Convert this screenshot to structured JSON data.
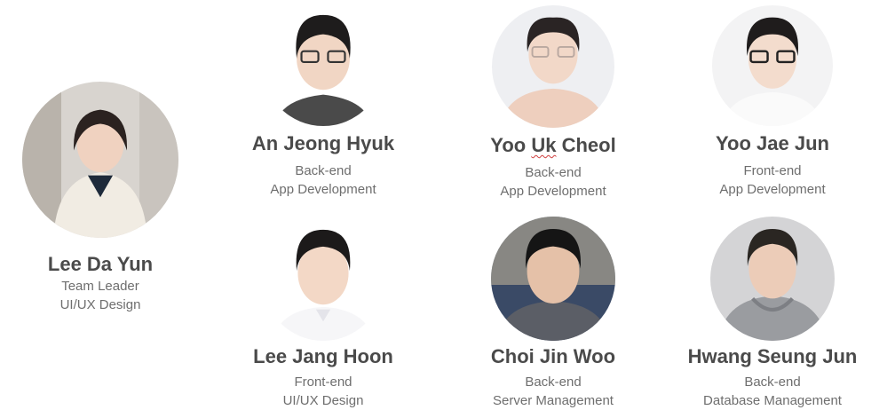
{
  "team": {
    "members": [
      {
        "name": "Lee Da Yun",
        "role1": "Team Leader",
        "role2": "UI/UX Design"
      },
      {
        "name": "An Jeong Hyuk",
        "role1": "Back-end",
        "role2": "App Development"
      },
      {
        "name_parts": [
          "Yoo ",
          "Uk",
          " Cheol"
        ],
        "role1": "Back-end",
        "role2": "App Development"
      },
      {
        "name": "Yoo Jae Jun",
        "role1": "Front-end",
        "role2": "App Development"
      },
      {
        "name": "Lee Jang Hoon",
        "role1": "Front-end",
        "role2": "UI/UX Design"
      },
      {
        "name": "Choi Jin Woo",
        "role1": "Back-end",
        "role2": "Server Management"
      },
      {
        "name": "Hwang Seung Jun",
        "role1": "Back-end",
        "role2": "Database Management"
      }
    ]
  },
  "colors": {
    "name_text": "#4a4a4a",
    "role_text": "#6e6e6e",
    "background": "#ffffff"
  }
}
